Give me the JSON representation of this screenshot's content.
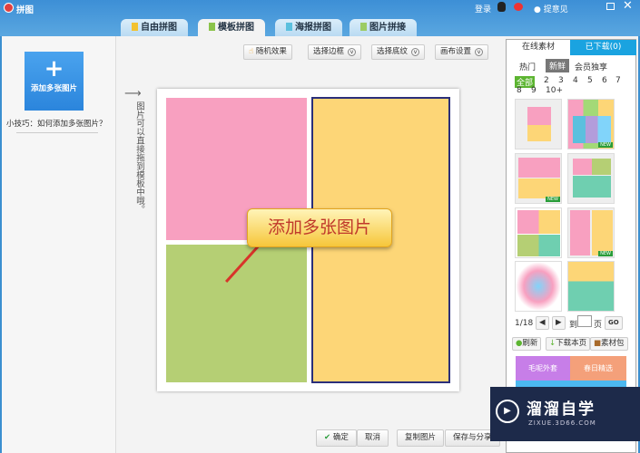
{
  "app": {
    "title": "拼图",
    "login": "登录",
    "feedback": "提意见"
  },
  "tabs": [
    {
      "label": "自由拼图"
    },
    {
      "label": "模板拼图"
    },
    {
      "label": "海报拼图"
    },
    {
      "label": "图片拼接"
    }
  ],
  "active_tab": "模板拼图",
  "left": {
    "add_button": "添加多张图片",
    "tip": "小技巧：如何添加多张图片？"
  },
  "toolbar": {
    "random": "随机效果",
    "border": "选择边框",
    "texture": "选择底纹",
    "canvas": "画布设置"
  },
  "canvas": {
    "hint": "图片可以直接拖到模板中哦。",
    "callout": "添加多张图片",
    "colors": {
      "pink": "#f8a0c0",
      "green": "#b5cf74",
      "yellow": "#fdd677",
      "border": "#2a2f7a"
    }
  },
  "right": {
    "tabs": [
      "在线素材",
      "已下载(0)"
    ],
    "filters": [
      "热门",
      "新鲜",
      "会员独享"
    ],
    "active_filter": "新鲜",
    "pages": [
      "全部",
      "2",
      "3",
      "4",
      "5",
      "6",
      "7",
      "8",
      "9",
      "10+"
    ],
    "new_badge": "NEW",
    "pager": {
      "current": "1/18",
      "goto": "到",
      "page": "页",
      "go": "GO"
    },
    "actions": [
      "刷新",
      "下载本页",
      "素材包"
    ],
    "banners": [
      "毛呢外套",
      "春日精选"
    ]
  },
  "bottom": {
    "confirm": "确定",
    "cancel": "取消",
    "copy": "复制图片",
    "save": "保存与分享"
  },
  "watermark": {
    "name": "溜溜自学",
    "url": "ZIXUE.3D66.COM"
  }
}
